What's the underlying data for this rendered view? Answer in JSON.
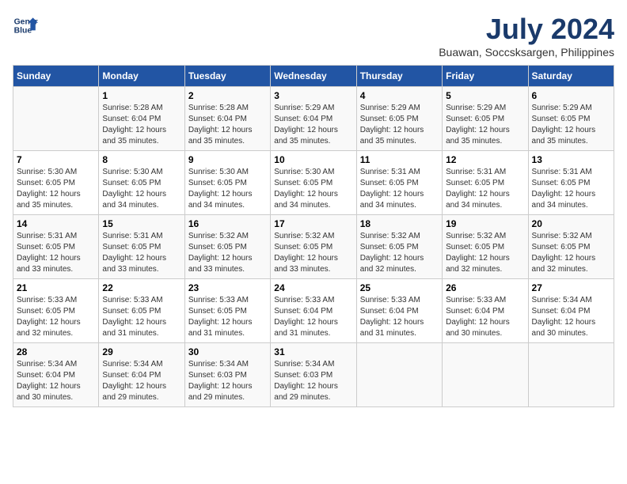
{
  "header": {
    "logo_line1": "General",
    "logo_line2": "Blue",
    "month": "July 2024",
    "location": "Buawan, Soccsksargen, Philippines"
  },
  "days_of_week": [
    "Sunday",
    "Monday",
    "Tuesday",
    "Wednesday",
    "Thursday",
    "Friday",
    "Saturday"
  ],
  "weeks": [
    [
      {
        "day": "",
        "info": ""
      },
      {
        "day": "1",
        "info": "Sunrise: 5:28 AM\nSunset: 6:04 PM\nDaylight: 12 hours\nand 35 minutes."
      },
      {
        "day": "2",
        "info": "Sunrise: 5:28 AM\nSunset: 6:04 PM\nDaylight: 12 hours\nand 35 minutes."
      },
      {
        "day": "3",
        "info": "Sunrise: 5:29 AM\nSunset: 6:04 PM\nDaylight: 12 hours\nand 35 minutes."
      },
      {
        "day": "4",
        "info": "Sunrise: 5:29 AM\nSunset: 6:05 PM\nDaylight: 12 hours\nand 35 minutes."
      },
      {
        "day": "5",
        "info": "Sunrise: 5:29 AM\nSunset: 6:05 PM\nDaylight: 12 hours\nand 35 minutes."
      },
      {
        "day": "6",
        "info": "Sunrise: 5:29 AM\nSunset: 6:05 PM\nDaylight: 12 hours\nand 35 minutes."
      }
    ],
    [
      {
        "day": "7",
        "info": "Sunrise: 5:30 AM\nSunset: 6:05 PM\nDaylight: 12 hours\nand 35 minutes."
      },
      {
        "day": "8",
        "info": "Sunrise: 5:30 AM\nSunset: 6:05 PM\nDaylight: 12 hours\nand 34 minutes."
      },
      {
        "day": "9",
        "info": "Sunrise: 5:30 AM\nSunset: 6:05 PM\nDaylight: 12 hours\nand 34 minutes."
      },
      {
        "day": "10",
        "info": "Sunrise: 5:30 AM\nSunset: 6:05 PM\nDaylight: 12 hours\nand 34 minutes."
      },
      {
        "day": "11",
        "info": "Sunrise: 5:31 AM\nSunset: 6:05 PM\nDaylight: 12 hours\nand 34 minutes."
      },
      {
        "day": "12",
        "info": "Sunrise: 5:31 AM\nSunset: 6:05 PM\nDaylight: 12 hours\nand 34 minutes."
      },
      {
        "day": "13",
        "info": "Sunrise: 5:31 AM\nSunset: 6:05 PM\nDaylight: 12 hours\nand 34 minutes."
      }
    ],
    [
      {
        "day": "14",
        "info": "Sunrise: 5:31 AM\nSunset: 6:05 PM\nDaylight: 12 hours\nand 33 minutes."
      },
      {
        "day": "15",
        "info": "Sunrise: 5:31 AM\nSunset: 6:05 PM\nDaylight: 12 hours\nand 33 minutes."
      },
      {
        "day": "16",
        "info": "Sunrise: 5:32 AM\nSunset: 6:05 PM\nDaylight: 12 hours\nand 33 minutes."
      },
      {
        "day": "17",
        "info": "Sunrise: 5:32 AM\nSunset: 6:05 PM\nDaylight: 12 hours\nand 33 minutes."
      },
      {
        "day": "18",
        "info": "Sunrise: 5:32 AM\nSunset: 6:05 PM\nDaylight: 12 hours\nand 32 minutes."
      },
      {
        "day": "19",
        "info": "Sunrise: 5:32 AM\nSunset: 6:05 PM\nDaylight: 12 hours\nand 32 minutes."
      },
      {
        "day": "20",
        "info": "Sunrise: 5:32 AM\nSunset: 6:05 PM\nDaylight: 12 hours\nand 32 minutes."
      }
    ],
    [
      {
        "day": "21",
        "info": "Sunrise: 5:33 AM\nSunset: 6:05 PM\nDaylight: 12 hours\nand 32 minutes."
      },
      {
        "day": "22",
        "info": "Sunrise: 5:33 AM\nSunset: 6:05 PM\nDaylight: 12 hours\nand 31 minutes."
      },
      {
        "day": "23",
        "info": "Sunrise: 5:33 AM\nSunset: 6:05 PM\nDaylight: 12 hours\nand 31 minutes."
      },
      {
        "day": "24",
        "info": "Sunrise: 5:33 AM\nSunset: 6:04 PM\nDaylight: 12 hours\nand 31 minutes."
      },
      {
        "day": "25",
        "info": "Sunrise: 5:33 AM\nSunset: 6:04 PM\nDaylight: 12 hours\nand 31 minutes."
      },
      {
        "day": "26",
        "info": "Sunrise: 5:33 AM\nSunset: 6:04 PM\nDaylight: 12 hours\nand 30 minutes."
      },
      {
        "day": "27",
        "info": "Sunrise: 5:34 AM\nSunset: 6:04 PM\nDaylight: 12 hours\nand 30 minutes."
      }
    ],
    [
      {
        "day": "28",
        "info": "Sunrise: 5:34 AM\nSunset: 6:04 PM\nDaylight: 12 hours\nand 30 minutes."
      },
      {
        "day": "29",
        "info": "Sunrise: 5:34 AM\nSunset: 6:04 PM\nDaylight: 12 hours\nand 29 minutes."
      },
      {
        "day": "30",
        "info": "Sunrise: 5:34 AM\nSunset: 6:03 PM\nDaylight: 12 hours\nand 29 minutes."
      },
      {
        "day": "31",
        "info": "Sunrise: 5:34 AM\nSunset: 6:03 PM\nDaylight: 12 hours\nand 29 minutes."
      },
      {
        "day": "",
        "info": ""
      },
      {
        "day": "",
        "info": ""
      },
      {
        "day": "",
        "info": ""
      }
    ]
  ]
}
